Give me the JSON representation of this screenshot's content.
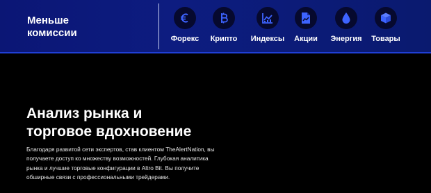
{
  "banner": {
    "title_line1": "Меньше",
    "title_line2": "комиссии",
    "accent_color": "#3d63ff",
    "categories": [
      {
        "label": "Форекс",
        "icon": "euro-icon"
      },
      {
        "label": "Крипто",
        "icon": "bitcoin-icon"
      },
      {
        "label": "Индексы",
        "icon": "chart-icon"
      },
      {
        "label": "Акции",
        "icon": "stock-document-icon"
      },
      {
        "label": "Энергия",
        "icon": "drop-icon"
      },
      {
        "label": "Товары",
        "icon": "box-icon"
      }
    ]
  },
  "main": {
    "headline_line1": "Анализ рынка и",
    "headline_line2": "торговое вдохновение",
    "body_lines": [
      "Благодаря развитой сети экспертов, став клиентом TheAlertNation, вы",
      "получаете доступ ко множеству возможностей. Глубокая аналитика",
      "рынка и лучшие торговые конфигурации в Altro Bit. Вы получите",
      "обширные связи с профессиональными трейдерами."
    ]
  }
}
